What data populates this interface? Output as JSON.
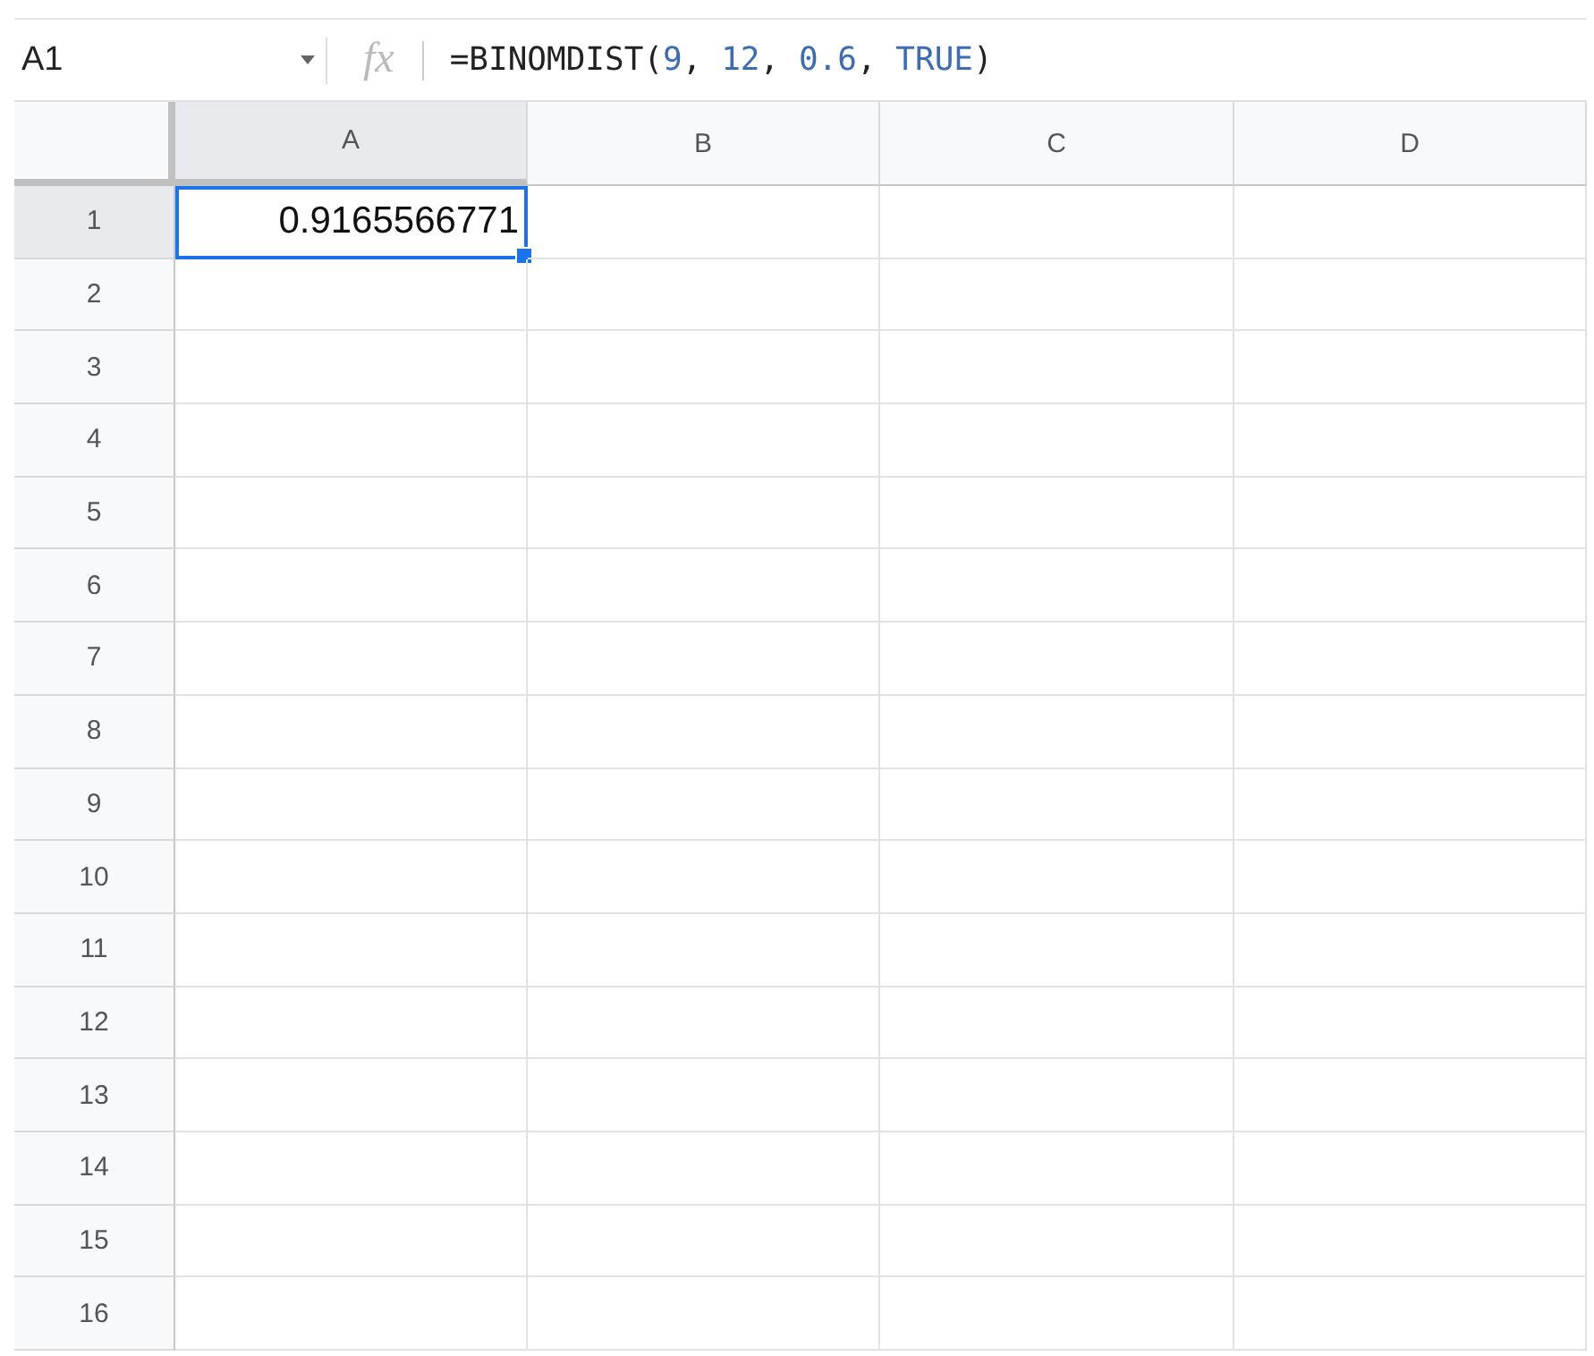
{
  "name_box": {
    "value": "A1"
  },
  "formula_bar": {
    "fx_label": "fx",
    "formula": [
      {
        "kind": "text",
        "text": "=BINOMDIST("
      },
      {
        "kind": "number",
        "text": "9"
      },
      {
        "kind": "text",
        "text": ", "
      },
      {
        "kind": "number",
        "text": "12"
      },
      {
        "kind": "text",
        "text": ", "
      },
      {
        "kind": "number",
        "text": "0.6"
      },
      {
        "kind": "text",
        "text": ", "
      },
      {
        "kind": "number",
        "text": "TRUE"
      },
      {
        "kind": "text",
        "text": ")"
      }
    ]
  },
  "columns": [
    {
      "label": "A",
      "selected": true
    },
    {
      "label": "B",
      "selected": false
    },
    {
      "label": "C",
      "selected": false
    },
    {
      "label": "D",
      "selected": false
    }
  ],
  "rows": [
    {
      "label": "1",
      "selected": true,
      "cells": [
        {
          "value": "0.9165566771",
          "selected": true
        }
      ]
    },
    {
      "label": "2",
      "selected": false
    },
    {
      "label": "3",
      "selected": false
    },
    {
      "label": "4",
      "selected": false
    },
    {
      "label": "5",
      "selected": false
    },
    {
      "label": "6",
      "selected": false
    },
    {
      "label": "7",
      "selected": false
    },
    {
      "label": "8",
      "selected": false
    },
    {
      "label": "9",
      "selected": false
    },
    {
      "label": "10",
      "selected": false
    },
    {
      "label": "11",
      "selected": false
    },
    {
      "label": "12",
      "selected": false
    },
    {
      "label": "13",
      "selected": false
    },
    {
      "label": "14",
      "selected": false
    },
    {
      "label": "15",
      "selected": false
    },
    {
      "label": "16",
      "selected": false
    }
  ]
}
